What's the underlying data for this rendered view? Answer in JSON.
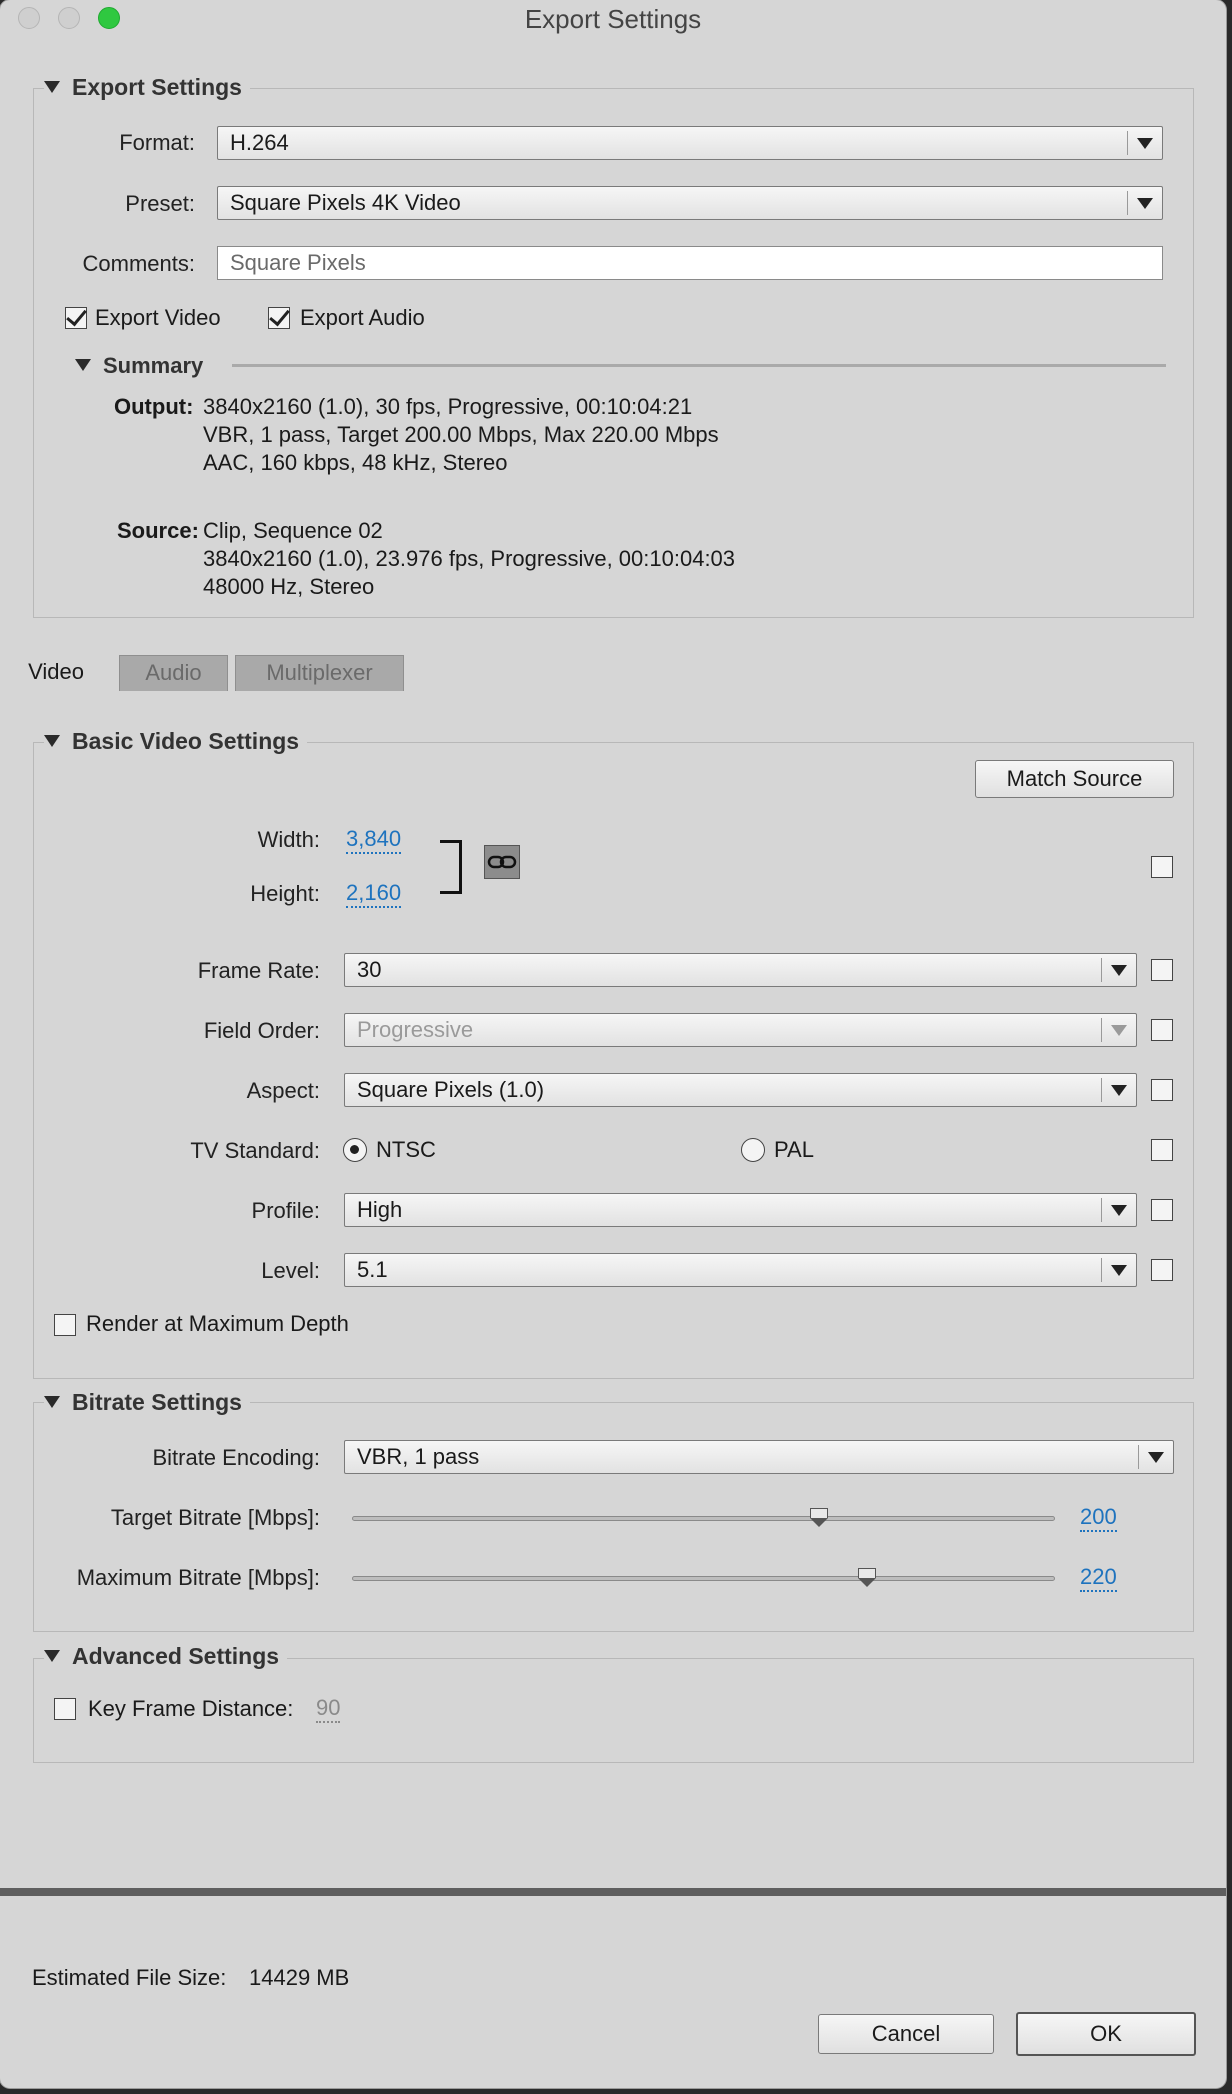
{
  "window": {
    "title": "Export Settings"
  },
  "export_settings": {
    "heading": "Export Settings",
    "format_label": "Format:",
    "format_value": "H.264",
    "preset_label": "Preset:",
    "preset_value": "Square Pixels 4K Video",
    "comments_label": "Comments:",
    "comments_value": "Square Pixels",
    "export_video_label": "Export Video",
    "export_audio_label": "Export Audio",
    "export_video_checked": true,
    "export_audio_checked": true
  },
  "summary": {
    "heading": "Summary",
    "output_label": "Output:",
    "output_lines": [
      "3840x2160 (1.0), 30 fps, Progressive, 00:10:04:21",
      "VBR, 1 pass, Target 200.00 Mbps, Max 220.00 Mbps",
      "AAC, 160 kbps, 48 kHz, Stereo"
    ],
    "source_label": "Source:",
    "source_lines": [
      "Clip, Sequence 02",
      "3840x2160 (1.0), 23.976 fps, Progressive, 00:10:04:03",
      "48000 Hz, Stereo"
    ]
  },
  "tabs": [
    {
      "label": "Video",
      "active": true
    },
    {
      "label": "Audio",
      "active": false
    },
    {
      "label": "Multiplexer",
      "active": false
    }
  ],
  "basic_video": {
    "heading": "Basic Video Settings",
    "match_source_label": "Match Source",
    "width_label": "Width:",
    "width_value": "3,840",
    "height_label": "Height:",
    "height_value": "2,160",
    "frame_rate_label": "Frame Rate:",
    "frame_rate_value": "30",
    "field_order_label": "Field Order:",
    "field_order_value": "Progressive",
    "aspect_label": "Aspect:",
    "aspect_value": "Square Pixels (1.0)",
    "tv_standard_label": "TV Standard:",
    "tv_ntsc_label": "NTSC",
    "tv_pal_label": "PAL",
    "tv_selected": "NTSC",
    "profile_label": "Profile:",
    "profile_value": "High",
    "level_label": "Level:",
    "level_value": "5.1",
    "render_max_depth_label": "Render at Maximum Depth"
  },
  "bitrate": {
    "heading": "Bitrate Settings",
    "encoding_label": "Bitrate Encoding:",
    "encoding_value": "VBR, 1 pass",
    "target_label": "Target Bitrate [Mbps]:",
    "target_value": "200",
    "target_fraction": 0.665,
    "max_label": "Maximum Bitrate [Mbps]:",
    "max_value": "220",
    "max_fraction": 0.732
  },
  "advanced": {
    "heading": "Advanced Settings",
    "keyframe_label": "Key Frame Distance:",
    "keyframe_value": "90"
  },
  "footer": {
    "estimated_label": "Estimated File Size:",
    "estimated_value": "14429 MB",
    "cancel_label": "Cancel",
    "ok_label": "OK"
  },
  "icons": {
    "link": "chain-link-icon",
    "disclosure": "triangle-down-icon"
  }
}
